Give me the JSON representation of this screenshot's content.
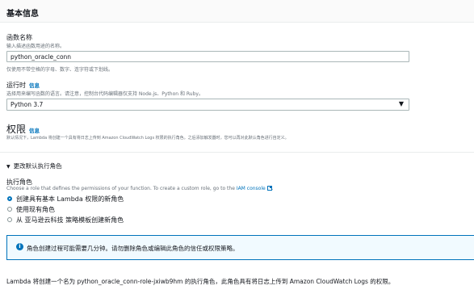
{
  "header": {
    "title": "基本信息"
  },
  "function_name": {
    "label": "函数名称",
    "help": "输入描述函数用途的名称。",
    "value": "python_oracle_conn",
    "constraint": "仅使用不带空格的字母、数字、连字符或下划线。"
  },
  "runtime": {
    "label": "运行时",
    "info": "信息",
    "help": "选择用来编写函数的语言。请注意，控制台代码编辑器仅支持 Node.js、Python 和 Ruby。",
    "selected": "Python 3.7"
  },
  "permissions": {
    "title": "权限",
    "info": "信息",
    "help": "默认情况下，Lambda 将创建一个具有将日志上传到 Amazon CloudWatch Logs 权限的执行角色。之后添加触发器时，您可以再对此默认角色进行自定义。"
  },
  "expander": {
    "label": "更改默认执行角色"
  },
  "execution_role": {
    "label": "执行角色",
    "help_prefix": "Choose a role that defines the permissions of your function. To create a custom role, go to the",
    "help_link": "IAM console",
    "options": [
      {
        "label": "创建具有基本 Lambda 权限的新角色",
        "selected": true
      },
      {
        "label": "使用现有角色",
        "selected": false
      },
      {
        "label": "从 亚马逊云科技 策略模板创建新角色",
        "selected": false
      }
    ]
  },
  "alert": {
    "icon": "info-icon",
    "text": "角色创建过程可能需要几分钟。请勿删除角色或编辑此角色的信任或权限策略。"
  },
  "footer": {
    "text": "Lambda 将创建一个名为 python_oracle_conn-role-jxiwb9hm 的执行角色，此角色具有将日志上传到 Amazon CloudWatch Logs 的权限。"
  },
  "colors": {
    "accent": "#0073bb",
    "text": "#16191f",
    "muted": "#687078",
    "alert_bg": "#f1faff"
  }
}
